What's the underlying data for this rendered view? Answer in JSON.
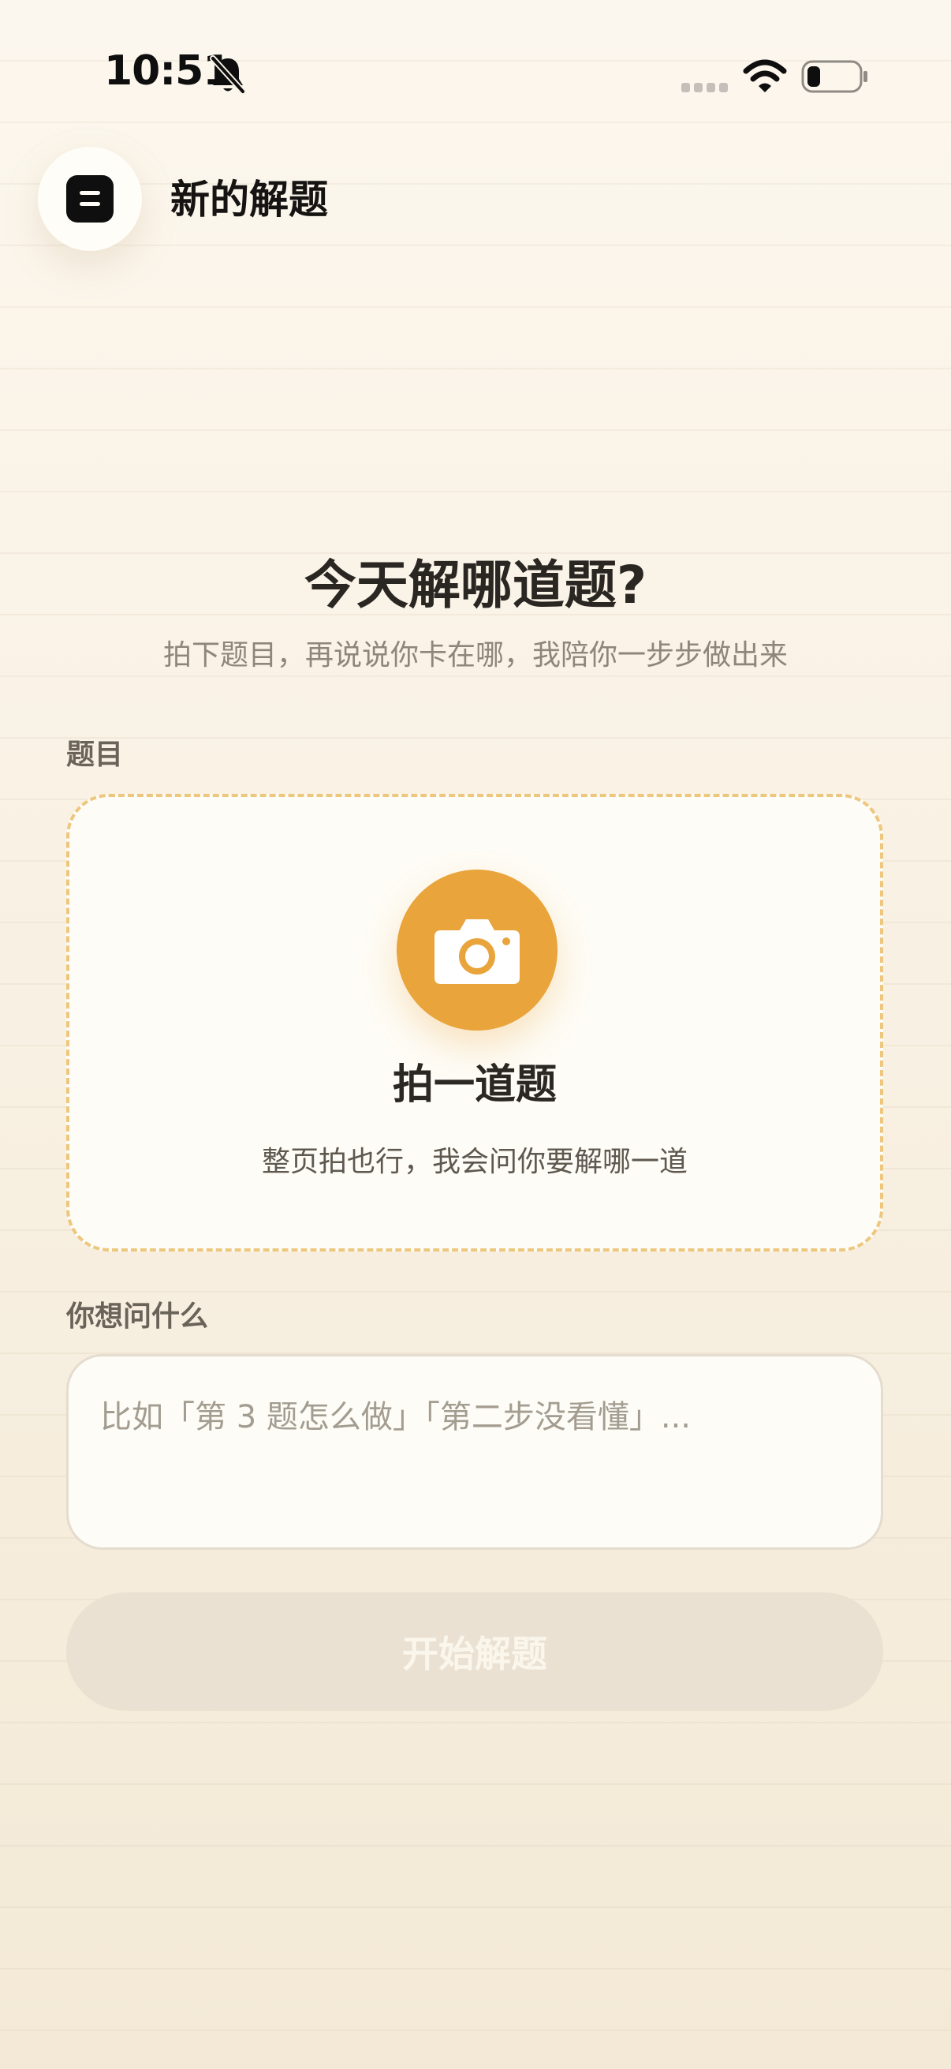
{
  "status_bar": {
    "time": "10:51",
    "icons": [
      "bell-slash-icon",
      "signal-icon",
      "wifi-icon",
      "battery-icon"
    ]
  },
  "header": {
    "menu_icon": "menu-icon",
    "title": "新的解题"
  },
  "hero": {
    "title": "今天解哪道题?",
    "subtitle": "拍下题目，再说说你卡在哪，我陪你一步步做出来"
  },
  "question": {
    "label": "题目",
    "upload_icon": "camera-icon",
    "upload_title": "拍一道题",
    "upload_hint": "整页拍也行，我会问你要解哪一道"
  },
  "ask": {
    "label": "你想问什么",
    "placeholder": "比如「第 3 题怎么做」「第二步没看懂」...",
    "value": ""
  },
  "start_button": {
    "label": "开始解题",
    "enabled": false
  },
  "colors": {
    "accent": "#e9a43b",
    "dashed_border": "#edc77e",
    "background": "#f8efe0",
    "button_disabled": "#eae1d2"
  }
}
